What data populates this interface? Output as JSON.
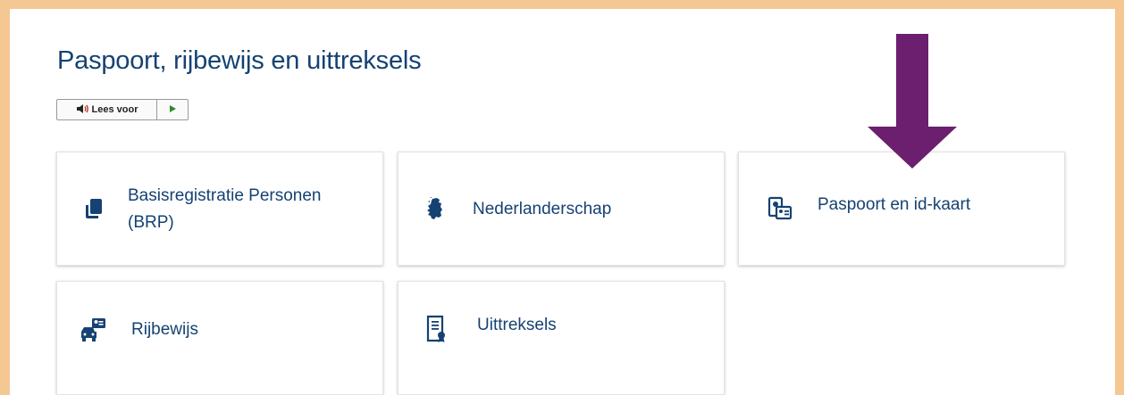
{
  "page": {
    "title": "Paspoort, rijbewijs en uittreksels"
  },
  "readspeaker": {
    "label": "Lees voor",
    "speaker_icon": "speaker-icon",
    "play_icon": "play-icon"
  },
  "tiles": [
    {
      "label": "Basisregistratie Personen (BRP)",
      "icon": "documents-icon"
    },
    {
      "label": "Nederlanderschap",
      "icon": "netherlands-map-icon"
    },
    {
      "label": "Paspoort en id-kaart",
      "icon": "passport-id-card-icon"
    },
    {
      "label": "Rijbewijs",
      "icon": "car-license-icon"
    },
    {
      "label": "Uittreksels",
      "icon": "certificate-icon"
    }
  ],
  "colors": {
    "frame": "#f5c792",
    "primary": "#154273",
    "arrow": "#6b1f6e"
  }
}
